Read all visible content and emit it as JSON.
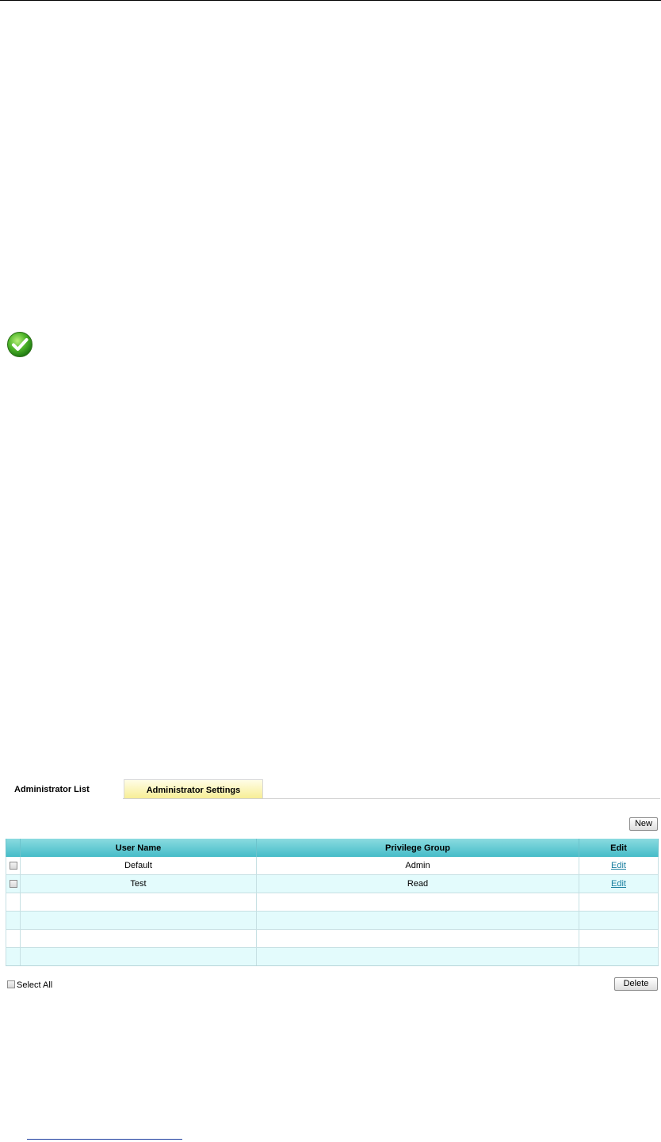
{
  "tabs": {
    "list_label": "Administrator List",
    "settings_label": "Administrator Settings"
  },
  "buttons": {
    "new_label": "New",
    "delete_label": "Delete"
  },
  "table": {
    "headers": {
      "user_name": "User Name",
      "privilege_group": "Privilege Group",
      "edit": "Edit"
    },
    "rows": [
      {
        "user_name": "Default",
        "privilege_group": "Admin",
        "edit": "Edit"
      },
      {
        "user_name": "Test",
        "privilege_group": "Read",
        "edit": "Edit"
      }
    ]
  },
  "select_all_label": "Select All",
  "colors": {
    "header_teal": "#45bcc8",
    "row_alt": "#e3fbfc",
    "tab_yellow": "#f7ee96",
    "link": "#1a7fa0"
  },
  "icons": {
    "status": "check-circle-icon"
  }
}
